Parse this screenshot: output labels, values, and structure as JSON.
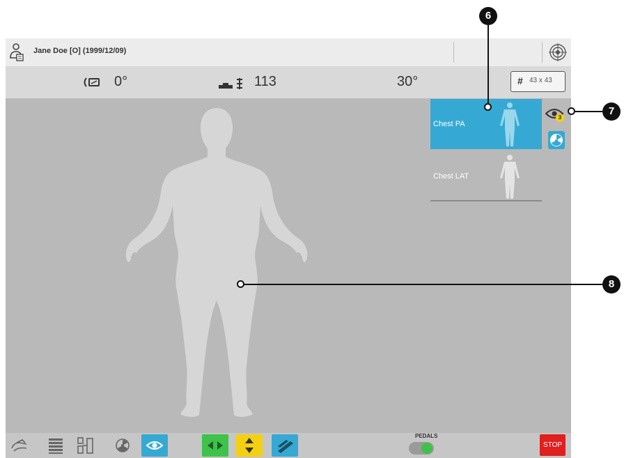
{
  "patient": {
    "name": "Jane Doe [O] (1999/12/09)"
  },
  "params": {
    "rotation": "0°",
    "height": "113",
    "angle": "30°",
    "detector_size": "43 x 43",
    "detector_hash": "#"
  },
  "procedures": [
    {
      "label": "Chest PA",
      "selected": true
    },
    {
      "label": "Chest LAT",
      "selected": false
    }
  ],
  "eye_badge": {
    "count": "3"
  },
  "toolbar": {
    "pedals_label": "PEDALS",
    "pedals_on": true,
    "stop_label": "STOP",
    "colors": {
      "eye": "#35a9d3",
      "horizontal": "#3fc24a",
      "vertical": "#f4d012",
      "tilt": "#35a9d3",
      "stop": "#e0201f"
    }
  },
  "callouts": {
    "c6": "6",
    "c7": "7",
    "c8": "8"
  },
  "icons": [
    "patient-icon",
    "target-icon",
    "rotation-icon",
    "table-height-icon",
    "eye-icon",
    "radiation-icon",
    "hand-icon",
    "grid-icon",
    "collimator-icon",
    "horizontal-arrows-icon",
    "vertical-arrows-icon",
    "tilt-icon"
  ]
}
